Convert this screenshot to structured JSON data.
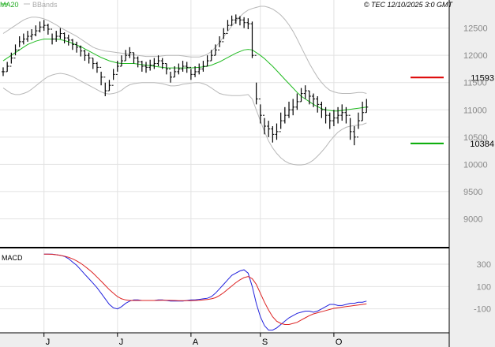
{
  "header": {
    "legend_ma": "MA20",
    "legend_bb": "BBands",
    "copyright": "© TEC 12/10/2025 3:0 GMT"
  },
  "colors": {
    "ma": "#22bb22",
    "bands": "#b8b8b8",
    "bars": "#000000",
    "macd": "#2222dd",
    "signal": "#dd2222",
    "resistance": "#dd0000",
    "support": "#00aa00",
    "grid": "#e2e2e2",
    "axis_panel": "#eeeeee"
  },
  "chart_data": [
    {
      "type": "ohlc",
      "ylim": [
        8500,
        12900
      ],
      "yticks": [
        9000,
        9500,
        10000,
        10500,
        11000,
        11500,
        12000,
        12500
      ],
      "ytick_labels": [
        "9000",
        "9500",
        "10000",
        "10500",
        "11000",
        "11500",
        "12000",
        "12500"
      ],
      "xlim": [
        0,
        99
      ],
      "xticks": [
        {
          "label": "J",
          "x": 10
        },
        {
          "label": "J",
          "x": 28
        },
        {
          "label": "A",
          "x": 46
        },
        {
          "label": "S",
          "x": 63
        },
        {
          "label": "O",
          "x": 81
        }
      ],
      "close": [
        11700,
        11800,
        11950,
        12100,
        12250,
        12300,
        12350,
        12380,
        12450,
        12520,
        12550,
        12480,
        12300,
        12350,
        12400,
        12320,
        12280,
        12200,
        12150,
        12080,
        12000,
        11950,
        11850,
        11780,
        11600,
        11350,
        11450,
        11650,
        11800,
        11900,
        12000,
        12050,
        11950,
        11880,
        11800,
        11780,
        11820,
        11850,
        11900,
        11850,
        11750,
        11600,
        11700,
        11750,
        11800,
        11780,
        11650,
        11700,
        11750,
        11800,
        11900,
        12000,
        12100,
        12250,
        12400,
        12550,
        12650,
        12680,
        12650,
        12600,
        12580,
        12000,
        11200,
        10900,
        10700,
        10650,
        10550,
        10600,
        10800,
        10900,
        11000,
        11050,
        11150,
        11300,
        11350,
        11250,
        11200,
        11100,
        11000,
        10900,
        10800,
        10850,
        10900,
        10950,
        10900,
        10600,
        10500,
        10800,
        10950,
        11050
      ],
      "high": [
        11780,
        11880,
        12050,
        12200,
        12350,
        12400,
        12450,
        12480,
        12550,
        12620,
        12650,
        12580,
        12400,
        12450,
        12500,
        12420,
        12380,
        12300,
        12250,
        12180,
        12100,
        12050,
        11950,
        11880,
        11700,
        11500,
        11550,
        11750,
        11900,
        12000,
        12100,
        12150,
        12050,
        11980,
        11900,
        11880,
        11920,
        11950,
        12000,
        11950,
        11850,
        11700,
        11800,
        11850,
        11900,
        11880,
        11750,
        11800,
        11850,
        11900,
        12000,
        12100,
        12200,
        12350,
        12500,
        12650,
        12730,
        12750,
        12720,
        12700,
        12680,
        12620,
        11500,
        11100,
        10850,
        10800,
        10700,
        10750,
        10950,
        11050,
        11150,
        11200,
        11300,
        11400,
        11450,
        11350,
        11300,
        11250,
        11150,
        11050,
        10950,
        11000,
        11050,
        11100,
        11050,
        10850,
        10700,
        10950,
        11150,
        11200
      ],
      "low": [
        11620,
        11700,
        11850,
        12000,
        12150,
        12200,
        12250,
        12280,
        12350,
        12420,
        12450,
        12380,
        12200,
        12250,
        12300,
        12220,
        12180,
        12100,
        12050,
        11980,
        11900,
        11850,
        11750,
        11680,
        11450,
        11250,
        11350,
        11550,
        11700,
        11800,
        11900,
        11950,
        11850,
        11780,
        11700,
        11680,
        11720,
        11750,
        11800,
        11750,
        11650,
        11500,
        11600,
        11650,
        11700,
        11680,
        11550,
        11600,
        11650,
        11700,
        11800,
        11900,
        12000,
        12150,
        12300,
        12450,
        12550,
        12580,
        12550,
        12500,
        12480,
        11950,
        11100,
        10750,
        10550,
        10500,
        10400,
        10450,
        10650,
        10750,
        10850,
        10900,
        11000,
        11150,
        11200,
        11100,
        11050,
        10950,
        10850,
        10750,
        10650,
        10700,
        10750,
        10800,
        10750,
        10450,
        10350,
        10650,
        10800,
        10950
      ],
      "ma20": [
        11900,
        11950,
        12000,
        12050,
        12100,
        12150,
        12200,
        12230,
        12260,
        12280,
        12300,
        12300,
        12300,
        12300,
        12290,
        12270,
        12250,
        12220,
        12190,
        12160,
        12120,
        12080,
        12040,
        12000,
        11960,
        11930,
        11900,
        11880,
        11860,
        11850,
        11850,
        11850,
        11850,
        11840,
        11830,
        11820,
        11810,
        11800,
        11790,
        11780,
        11770,
        11770,
        11770,
        11770,
        11770,
        11770,
        11770,
        11775,
        11780,
        11790,
        11800,
        11820,
        11850,
        11880,
        11920,
        11960,
        12000,
        12040,
        12070,
        12100,
        12110,
        12100,
        12050,
        12000,
        11940,
        11870,
        11800,
        11720,
        11640,
        11560,
        11480,
        11400,
        11320,
        11250,
        11200,
        11150,
        11100,
        11060,
        11020,
        11000,
        10990,
        10980,
        10980,
        10990,
        11000,
        11010,
        11020,
        11030,
        11040,
        11050
      ],
      "bb_upper": [
        12400,
        12450,
        12500,
        12550,
        12600,
        12650,
        12680,
        12700,
        12700,
        12690,
        12670,
        12640,
        12600,
        12560,
        12510,
        12470,
        12430,
        12390,
        12350,
        12300,
        12250,
        12200,
        12150,
        12120,
        12100,
        12080,
        12070,
        12060,
        12050,
        12040,
        12030,
        12020,
        12010,
        12000,
        11990,
        11980,
        11980,
        11980,
        11980,
        11990,
        12000,
        12000,
        12000,
        12000,
        11990,
        11980,
        11970,
        11970,
        11970,
        11990,
        12020,
        12070,
        12150,
        12240,
        12340,
        12440,
        12540,
        12630,
        12710,
        12780,
        12830,
        12860,
        12880,
        12900,
        12900,
        12880,
        12850,
        12800,
        12740,
        12660,
        12560,
        12440,
        12300,
        12150,
        12000,
        11850,
        11720,
        11600,
        11500,
        11420,
        11360,
        11330,
        11310,
        11300,
        11300,
        11300,
        11310,
        11320,
        11320,
        11300
      ],
      "bb_lower": [
        11400,
        11350,
        11300,
        11280,
        11280,
        11300,
        11330,
        11380,
        11440,
        11500,
        11560,
        11610,
        11640,
        11660,
        11670,
        11660,
        11640,
        11610,
        11570,
        11530,
        11490,
        11450,
        11410,
        11370,
        11330,
        11300,
        11290,
        11300,
        11320,
        11360,
        11420,
        11460,
        11480,
        11490,
        11500,
        11500,
        11500,
        11500,
        11490,
        11480,
        11460,
        11440,
        11440,
        11450,
        11470,
        11480,
        11490,
        11500,
        11500,
        11480,
        11450,
        11400,
        11350,
        11300,
        11280,
        11270,
        11260,
        11260,
        11260,
        11270,
        11280,
        11200,
        11000,
        10800,
        10600,
        10430,
        10300,
        10200,
        10120,
        10060,
        10020,
        10000,
        9990,
        9990,
        10000,
        10030,
        10080,
        10150,
        10230,
        10320,
        10420,
        10510,
        10590,
        10640,
        10680,
        10700,
        10710,
        10720,
        10730,
        10760
      ],
      "levels": [
        {
          "name": "resistance",
          "value": 11593,
          "label": "11593"
        },
        {
          "name": "support",
          "value": 10384,
          "label": "10384"
        }
      ]
    },
    {
      "type": "line",
      "title": "MACD",
      "ylim": [
        -300,
        420
      ],
      "yticks": [
        300,
        100,
        -100
      ],
      "ytick_labels": [
        "300",
        "100",
        "-100"
      ],
      "macd": [
        390,
        390,
        390,
        385,
        380,
        370,
        350,
        320,
        290,
        250,
        210,
        170,
        130,
        90,
        40,
        -10,
        -60,
        -90,
        -100,
        -80,
        -50,
        -30,
        -20,
        -20,
        -25,
        -25,
        -25,
        -25,
        -20,
        -20,
        -25,
        -30,
        -30,
        -30,
        -30,
        -25,
        -20,
        -20,
        -15,
        -10,
        -5,
        10,
        40,
        80,
        120,
        160,
        200,
        220,
        240,
        250,
        220,
        100,
        -50,
        -170,
        -250,
        -290,
        -290,
        -270,
        -240,
        -210,
        -180,
        -160,
        -140,
        -130,
        -120,
        -120,
        -130,
        -120,
        -100,
        -80,
        -60,
        -60,
        -70,
        -70,
        -60,
        -50,
        -50,
        -40,
        -40,
        -30
      ],
      "signal": [
        390,
        390,
        388,
        385,
        380,
        372,
        362,
        348,
        330,
        308,
        282,
        252,
        220,
        185,
        148,
        110,
        72,
        40,
        10,
        -10,
        -20,
        -25,
        -25,
        -25,
        -25,
        -25,
        -25,
        -25,
        -24,
        -23,
        -23,
        -24,
        -25,
        -26,
        -27,
        -27,
        -26,
        -25,
        -23,
        -20,
        -16,
        -10,
        0,
        20,
        45,
        75,
        105,
        135,
        160,
        180,
        190,
        170,
        120,
        40,
        -40,
        -110,
        -170,
        -210,
        -230,
        -240,
        -240,
        -230,
        -220,
        -200,
        -180,
        -160,
        -145,
        -135,
        -125,
        -115,
        -105,
        -95,
        -90,
        -85,
        -80,
        -75,
        -70,
        -65,
        -60,
        -55
      ]
    }
  ]
}
